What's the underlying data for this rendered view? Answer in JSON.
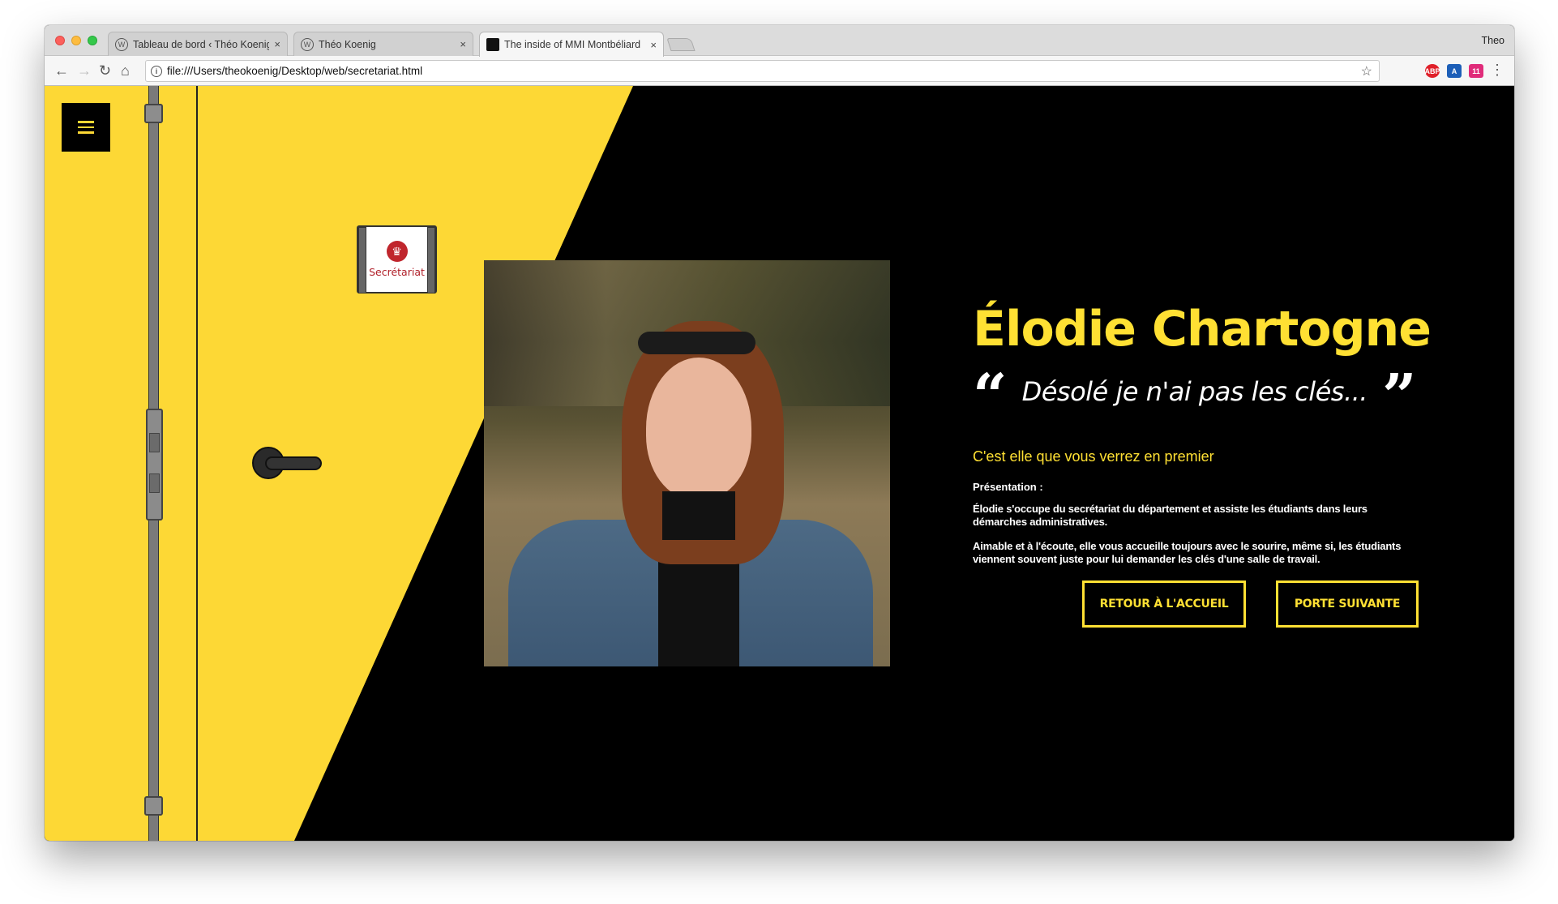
{
  "browser": {
    "tabs": [
      {
        "label": "Tableau de bord ‹ Théo Koenig",
        "close": "×"
      },
      {
        "label": "Théo Koenig",
        "close": "×"
      },
      {
        "label": "The inside of MMI Montbéliard",
        "close": "×"
      }
    ],
    "profile": "Theo",
    "url": "file:///Users/theokoenig/Desktop/web/secretariat.html",
    "nav": {
      "back": "←",
      "forward": "→",
      "reload": "↻",
      "home": "⌂",
      "info": "i",
      "star": "☆",
      "menu": "⋮"
    },
    "extensions": [
      {
        "name": "adblock-icon",
        "label": "ABP",
        "color": "#e0202a"
      },
      {
        "name": "translate-icon",
        "label": "A",
        "color": "#1d5fb8"
      },
      {
        "name": "calendar-icon",
        "label": "11",
        "color": "#e02c7a"
      }
    ]
  },
  "page": {
    "menu_icon": "hamburger-icon",
    "door_sign": {
      "logo": "♛",
      "label": "Secrétariat"
    },
    "person": {
      "name": "Élodie Chartogne",
      "quote": "Désolé je n'ai pas les clés...",
      "quote_open": "“",
      "quote_close": "”",
      "subtitle": "C'est elle que vous verrez en premier",
      "presentation_label": "Présentation :",
      "paragraphs": [
        "Élodie s'occupe du secrétariat du département et assiste les étudiants dans leurs démarches administratives.",
        "Aimable et à l'écoute, elle vous accueille toujours avec le sourire, même si, les étudiants viennent souvent juste pour lui demander les clés d'une salle de travail."
      ]
    },
    "buttons": {
      "home": "RETOUR À L'ACCUEIL",
      "next": "PORTE SUIVANTE"
    },
    "colors": {
      "accent": "#ffe033",
      "door": "#fdd835",
      "background": "#000000"
    }
  }
}
